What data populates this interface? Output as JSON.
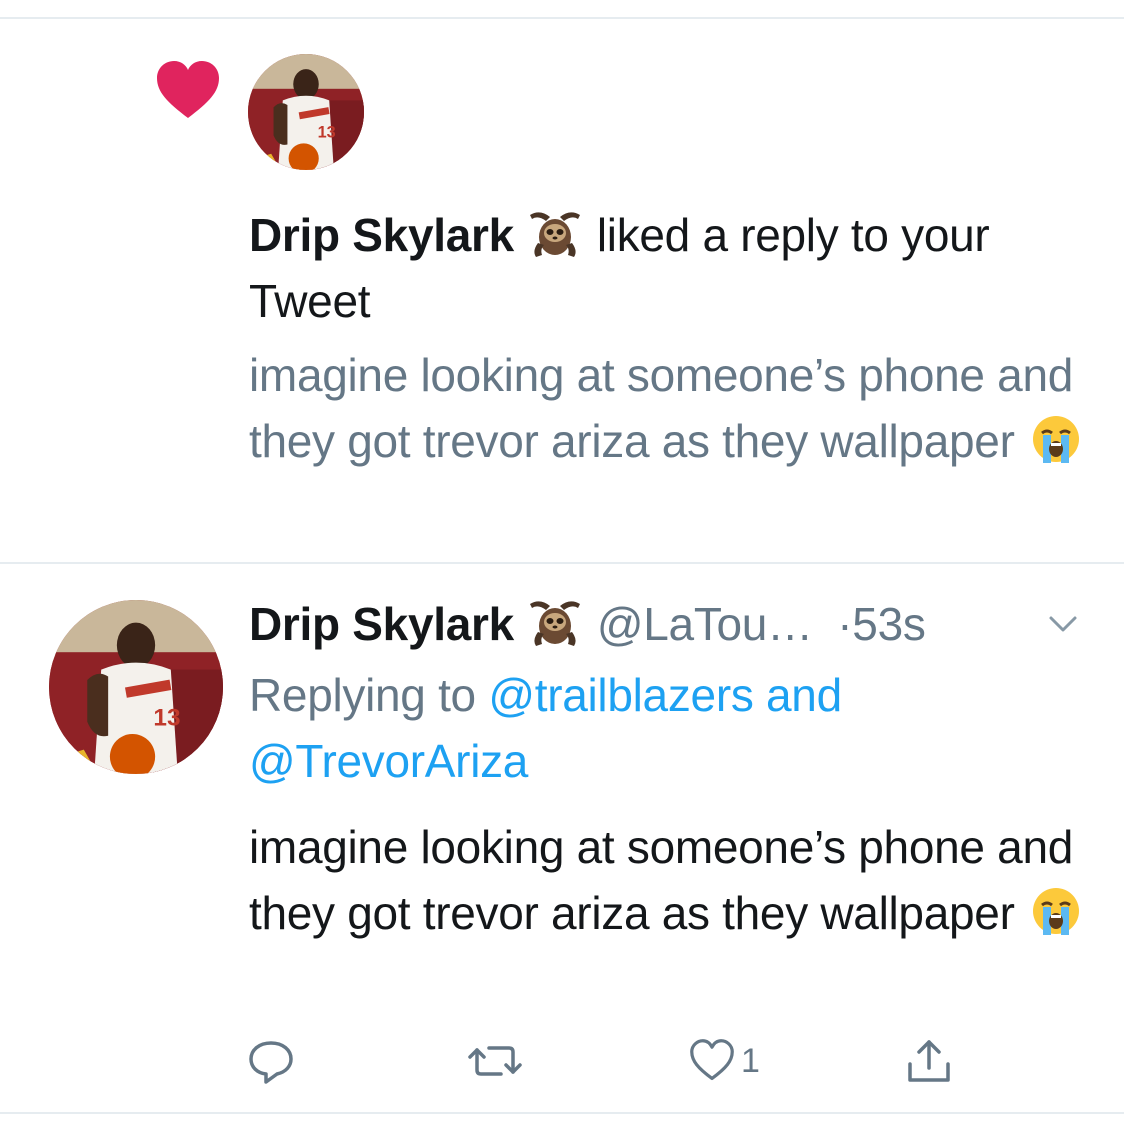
{
  "notification": {
    "user_name": "Drip Skylark",
    "action_text": " liked a reply to your Tweet",
    "tweet_text": "imagine looking at someone’s phone and they got trevor ariza as they wallpaper"
  },
  "tweet": {
    "user_name": "Drip Skylark",
    "handle": "@LaTou…",
    "time": "·53s",
    "replying_prefix": "Replying to ",
    "replying_to": "@trailblazers and @TrevorAriza",
    "text": "imagine looking at someone’s phone and they got trevor ariza as they wallpaper",
    "like_count": "1"
  },
  "icons": {
    "notification_type": "heart-icon",
    "name_emoji": "sloth-emoji-icon",
    "text_emoji": "loudly-crying-face-emoji-icon",
    "caret": "chevron-down-icon",
    "reply": "reply-icon",
    "retweet": "retweet-icon",
    "like": "like-icon",
    "share": "share-icon"
  },
  "colors": {
    "heart": "#e0245e",
    "secondary_text": "#657786",
    "link": "#1da1f2",
    "divider": "#e6ecf0"
  }
}
